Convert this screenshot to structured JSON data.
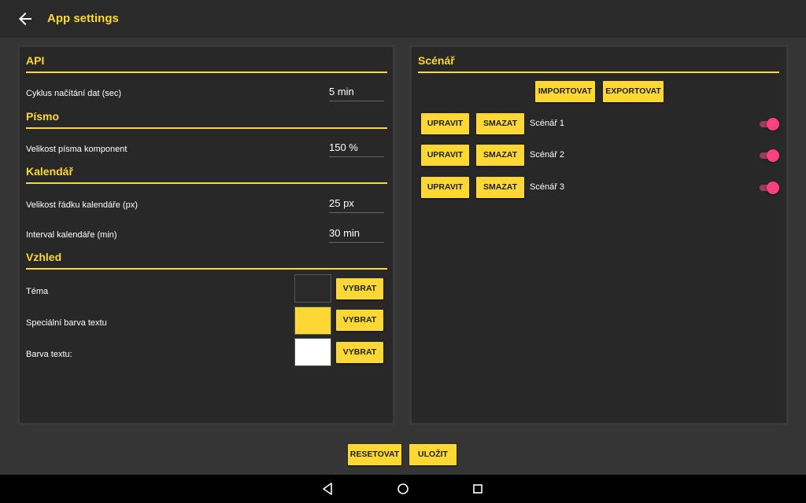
{
  "header": {
    "title": "App settings",
    "back_icon": "back-arrow-icon"
  },
  "colors": {
    "accent": "#fdd835",
    "panel": "#282828",
    "background": "#353535",
    "toggle": "#ff4081"
  },
  "settings": {
    "api": {
      "title": "API",
      "data_cycle_label": "Cyklus načítání dat (sec)",
      "data_cycle_value": "5 min"
    },
    "font": {
      "title": "Písmo",
      "size_label": "Velikost písma komponent",
      "size_value": "150 %"
    },
    "calendar": {
      "title": "Kalendář",
      "row_size_label": "Velikost řádku kalendáře (px)",
      "row_size_value": "25 px",
      "interval_label": "Interval kalendáře (min)",
      "interval_value": "30 min"
    },
    "appearance": {
      "title": "Vzhled",
      "theme_label": "Téma",
      "theme_color": "#2a2a2a",
      "special_text_label": "Speciální barva textu",
      "special_text_color": "#fdd835",
      "text_color_label": "Barva textu:",
      "text_color": "#ffffff",
      "select_label": "VYBRAT"
    }
  },
  "scenarios": {
    "title": "Scénář",
    "import_label": "IMPORTOVAT",
    "export_label": "EXPORTOVAT",
    "edit_label": "UPRAVIT",
    "delete_label": "SMAZAT",
    "items": [
      {
        "name": "Scénář 1",
        "enabled": true
      },
      {
        "name": "Scénář 2",
        "enabled": true
      },
      {
        "name": "Scénář 3",
        "enabled": true
      }
    ]
  },
  "footer": {
    "reset_label": "RESETOVAT",
    "save_label": "ULOŽIT"
  },
  "navbar": {
    "back_icon": "nav-back-icon",
    "home_icon": "nav-home-icon",
    "recents_icon": "nav-recents-icon"
  }
}
